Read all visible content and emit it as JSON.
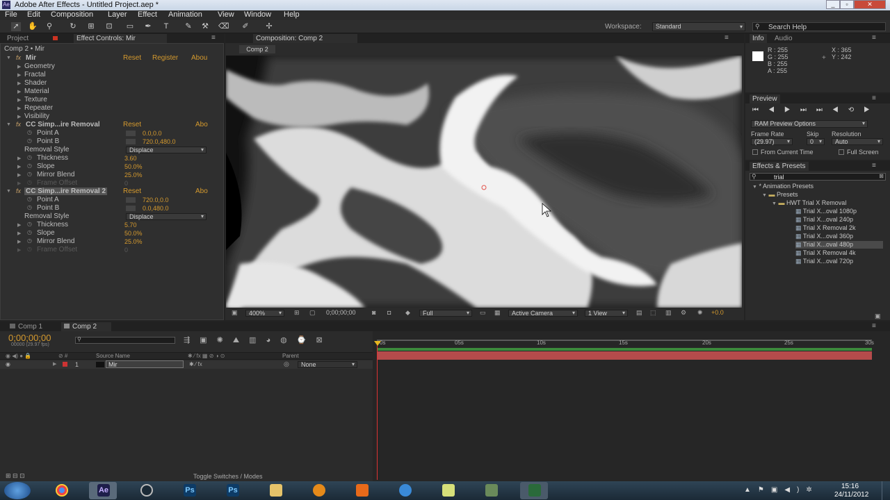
{
  "app": {
    "title": "Adobe After Effects - Untitled Project.aep *",
    "icon_text": "Ae"
  },
  "menu": [
    "File",
    "Edit",
    "Composition",
    "Layer",
    "Effect",
    "Animation",
    "View",
    "Window",
    "Help"
  ],
  "workspace": {
    "label": "Workspace:",
    "value": "Standard",
    "search_placeholder": "Search Help"
  },
  "project_tab": "Project",
  "effect_controls": {
    "tab": "Effect Controls: Mir",
    "breadcrumb": "Comp 2 • Mir",
    "mir": {
      "name": "Mir",
      "reset": "Reset",
      "register": "Register",
      "about": "Abou",
      "groups": [
        "Geometry",
        "Fractal",
        "Shader",
        "Material",
        "Texture",
        "Repeater",
        "Visibility"
      ]
    },
    "removal1": {
      "name": "CC Simp...ire Removal",
      "reset": "Reset",
      "about": "Abo",
      "point_a_label": "Point A",
      "point_a": "0.0,0.0",
      "point_b_label": "Point B",
      "point_b": "720.0,480.0",
      "style_label": "Removal Style",
      "style": "Displace",
      "thickness_label": "Thickness",
      "thickness": "3.60",
      "slope_label": "Slope",
      "slope": "50.0%",
      "mirror_label": "Mirror Blend",
      "mirror": "25.0%",
      "frame_label": "Frame Offset",
      "frame": "0"
    },
    "removal2": {
      "name": "CC Simp...ire Removal 2",
      "reset": "Reset",
      "about": "Abo",
      "point_a_label": "Point A",
      "point_a": "720.0,0.0",
      "point_b_label": "Point B",
      "point_b": "0.0,480.0",
      "style_label": "Removal Style",
      "style": "Displace",
      "thickness_label": "Thickness",
      "thickness": "5.70",
      "slope_label": "Slope",
      "slope": "50.0%",
      "mirror_label": "Mirror Blend",
      "mirror": "25.0%",
      "frame_label": "Frame Offset",
      "frame": "0"
    }
  },
  "composition": {
    "tab": "Composition: Comp 2",
    "subtab": "Comp 2",
    "zoom": "400%",
    "timecode": "0;00;00;00",
    "resolution": "Full",
    "camera": "Active Camera",
    "views": "1 View",
    "exposure": "+0.0"
  },
  "info": {
    "tab": "Info",
    "audio_tab": "Audio",
    "r": "R : 255",
    "g": "G : 255",
    "b": "B : 255",
    "a": "A : 255",
    "x": "X : 365",
    "y": "Y : 242"
  },
  "preview": {
    "tab": "Preview",
    "options": "RAM Preview Options",
    "frame_rate_label": "Frame Rate",
    "frame_rate": "(29.97)",
    "skip_label": "Skip",
    "skip": "0",
    "resolution_label": "Resolution",
    "resolution": "Auto",
    "from_current": "From Current Time",
    "full_screen": "Full Screen"
  },
  "effects_presets": {
    "tab": "Effects & Presets",
    "search": "trial",
    "tree": [
      "* Animation Presets",
      "Presets",
      "HWT Trial X Removal",
      "Trial X...oval 1080p",
      "Trial X...oval 240p",
      "Trial X Removal 2k",
      "Trial X...oval 360p",
      "Trial X...oval 480p",
      "Trial X Removal 4k",
      "Trial X...oval 720p"
    ]
  },
  "timeline": {
    "tabs": [
      "Comp 1",
      "Comp 2"
    ],
    "timecode": "0;00;00;00",
    "fps": "00000 (29.97 fps)",
    "col_source": "Source Name",
    "col_parent": "Parent",
    "layer_num": "1",
    "layer_name": "Mir",
    "parent": "None",
    "ticks": [
      "0s",
      "05s",
      "10s",
      "15s",
      "20s",
      "25s",
      "30s"
    ],
    "toggle": "Toggle Switches / Modes"
  },
  "taskbar": {
    "time": "15:16",
    "date": "24/11/2012",
    "apps": [
      "chrome",
      "Ae",
      "cc",
      "Ps",
      "Ps",
      "folder",
      "media",
      "mail",
      "itunes",
      "notes",
      "tools",
      "excel"
    ]
  }
}
